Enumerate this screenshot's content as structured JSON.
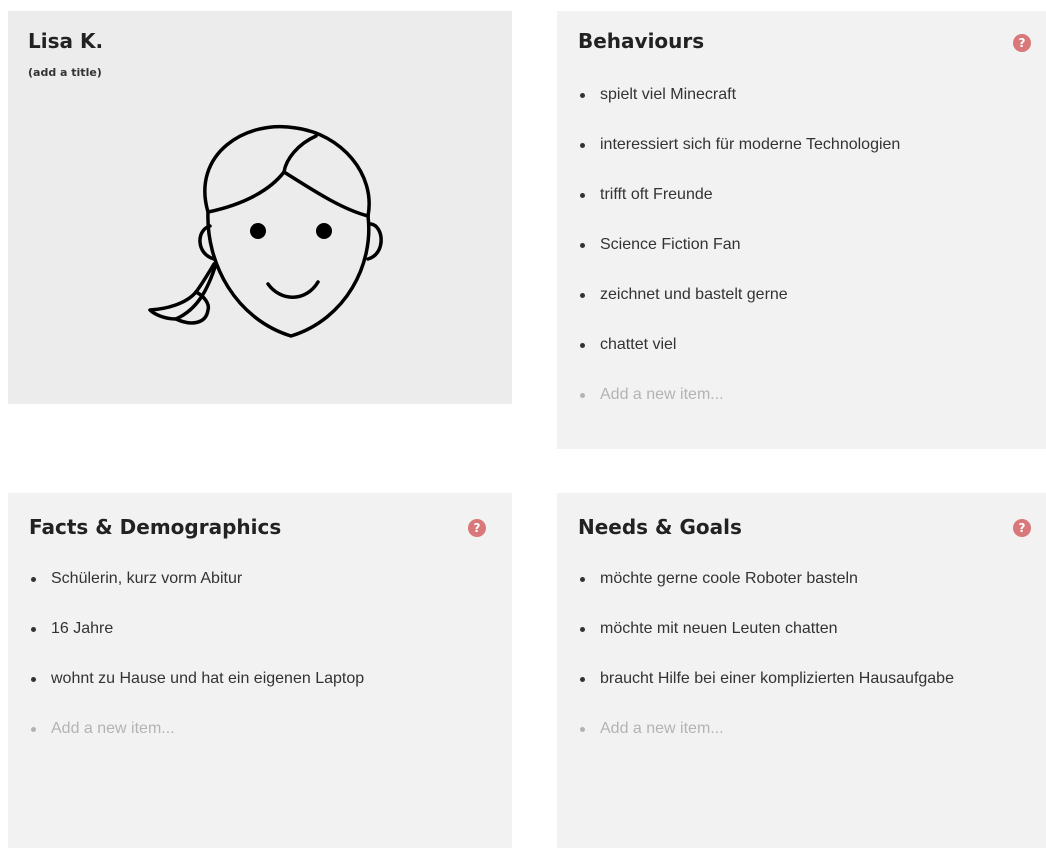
{
  "persona": {
    "name": "Lisa K.",
    "title_placeholder": "(add a title)",
    "avatar_icon": "girl-face-icon"
  },
  "behaviours": {
    "title": "Behaviours",
    "help_icon": "?",
    "items": [
      "spielt viel Minecraft",
      "interessiert sich für moderne Technologien",
      "trifft oft Freunde",
      "Science Fiction Fan",
      "zeichnet und bastelt gerne",
      "chattet viel"
    ],
    "add_placeholder": "Add a new item..."
  },
  "facts": {
    "title": "Facts & Demographics",
    "help_icon": "?",
    "items": [
      "Schülerin, kurz vorm Abitur",
      "16 Jahre",
      "wohnt zu Hause und hat ein eigenen Laptop"
    ],
    "add_placeholder": "Add a new item..."
  },
  "needs": {
    "title": "Needs & Goals",
    "help_icon": "?",
    "items": [
      "möchte gerne coole Roboter basteln",
      "möchte mit neuen Leuten chatten",
      "braucht Hilfe bei einer komplizierten Hausaufgabe"
    ],
    "add_placeholder": "Add a new item..."
  },
  "colors": {
    "card_bg": "#f2f2f2",
    "persona_bg": "#ececec",
    "help_icon": "#d9787a",
    "placeholder": "#b3b3b3"
  }
}
